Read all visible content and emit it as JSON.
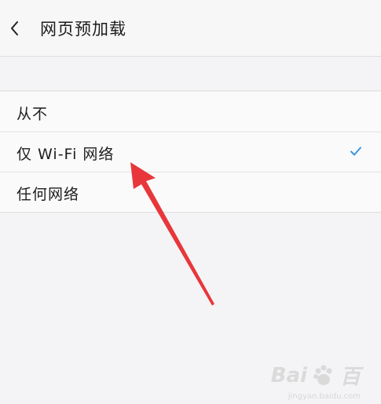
{
  "header": {
    "title": "网页预加载",
    "back_icon": "chevron-left-icon"
  },
  "options": [
    {
      "label": "从不",
      "selected": false
    },
    {
      "label": "仅 Wi-Fi 网络",
      "selected": true
    },
    {
      "label": "任何网络",
      "selected": false
    }
  ],
  "colors": {
    "check": "#3a95e0",
    "arrow": "#e8373a"
  },
  "watermark": {
    "brand": "Bai",
    "brand_tail": "百",
    "sub": "jingyan.baidu.com",
    "icon": "paw-icon"
  }
}
